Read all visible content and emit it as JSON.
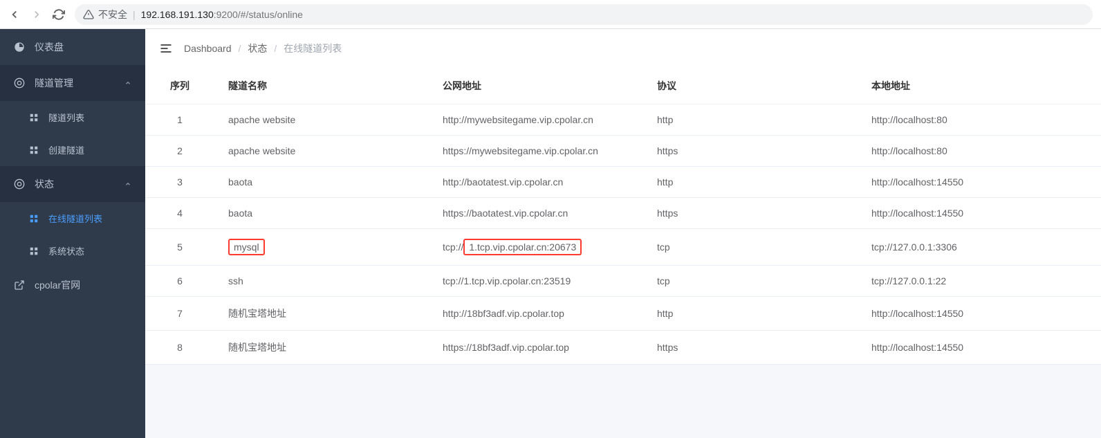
{
  "browser": {
    "security_label": "不安全",
    "url_host": "192.168.191.130",
    "url_port": ":9200",
    "url_path": "/#/status/online"
  },
  "sidebar": {
    "dashboard": "仪表盘",
    "tunnel_mgmt": "隧道管理",
    "tunnel_list": "隧道列表",
    "tunnel_create": "创建隧道",
    "status": "状态",
    "online_list": "在线隧道列表",
    "system_status": "系统状态",
    "cpolar_site": "cpolar官网"
  },
  "breadcrumb": {
    "item1": "Dashboard",
    "item2": "状态",
    "item3": "在线隧道列表"
  },
  "table": {
    "headers": {
      "seq": "序列",
      "name": "隧道名称",
      "public_url": "公网地址",
      "protocol": "协议",
      "local_url": "本地地址"
    },
    "rows": [
      {
        "seq": "1",
        "name": "apache website",
        "public_url": "http://mywebsitegame.vip.cpolar.cn",
        "protocol": "http",
        "local_url": "http://localhost:80"
      },
      {
        "seq": "2",
        "name": "apache website",
        "public_url": "https://mywebsitegame.vip.cpolar.cn",
        "protocol": "https",
        "local_url": "http://localhost:80"
      },
      {
        "seq": "3",
        "name": "baota",
        "public_url": "http://baotatest.vip.cpolar.cn",
        "protocol": "http",
        "local_url": "http://localhost:14550"
      },
      {
        "seq": "4",
        "name": "baota",
        "public_url": "https://baotatest.vip.cpolar.cn",
        "protocol": "https",
        "local_url": "http://localhost:14550"
      },
      {
        "seq": "5",
        "name": "mysql",
        "public_url_prefix": "tcp://",
        "public_url_hl": "1.tcp.vip.cpolar.cn:20673",
        "protocol": "tcp",
        "local_url": "tcp://127.0.0.1:3306",
        "highlight": true
      },
      {
        "seq": "6",
        "name": "ssh",
        "public_url": "tcp://1.tcp.vip.cpolar.cn:23519",
        "protocol": "tcp",
        "local_url": "tcp://127.0.0.1:22"
      },
      {
        "seq": "7",
        "name": "随机宝塔地址",
        "public_url": "http://18bf3adf.vip.cpolar.top",
        "protocol": "http",
        "local_url": "http://localhost:14550"
      },
      {
        "seq": "8",
        "name": "随机宝塔地址",
        "public_url": "https://18bf3adf.vip.cpolar.top",
        "protocol": "https",
        "local_url": "http://localhost:14550"
      }
    ]
  }
}
